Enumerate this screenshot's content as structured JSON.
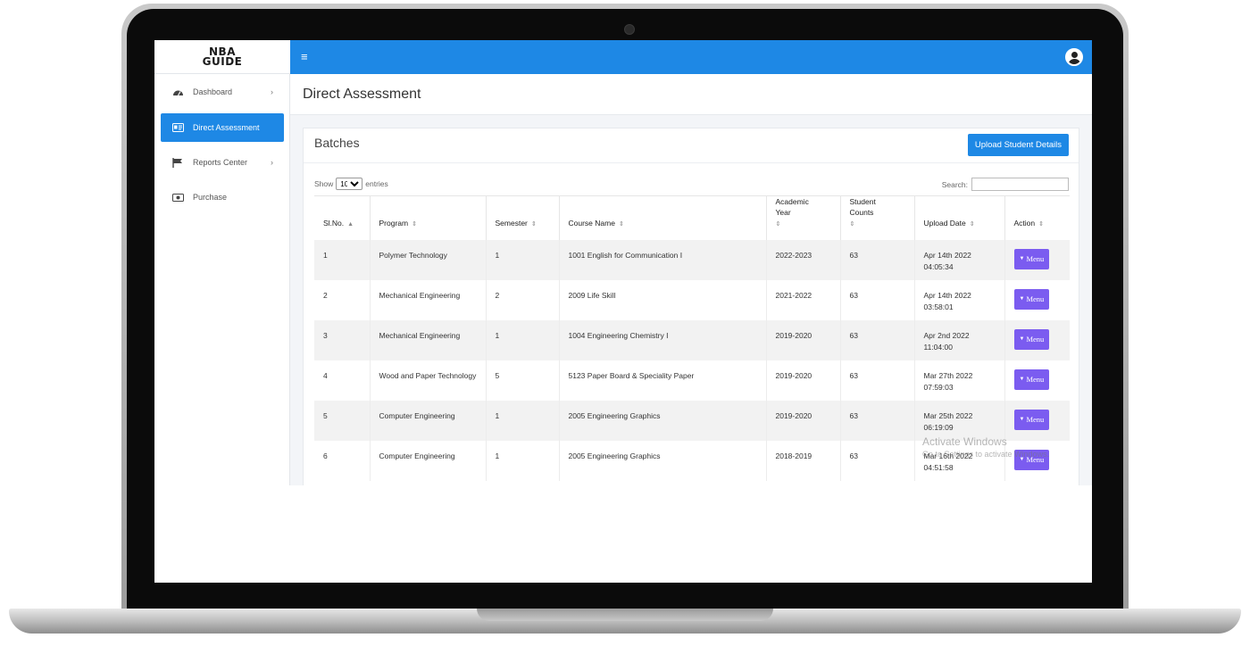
{
  "brand": {
    "logo_line1": "NBA",
    "logo_line2": "GUIDE"
  },
  "topbar": {
    "menu_icon": "hamburger-icon",
    "user_icon": "user-avatar-icon"
  },
  "sidebar": {
    "items": [
      {
        "label": "Dashboard",
        "icon": "dashboard-gauge-icon",
        "has_chevron": true,
        "active": false
      },
      {
        "label": "Direct Assessment",
        "icon": "id-card-icon",
        "has_chevron": false,
        "active": true
      },
      {
        "label": "Reports Center",
        "icon": "flag-icon",
        "has_chevron": true,
        "active": false
      },
      {
        "label": "Purchase",
        "icon": "money-bill-icon",
        "has_chevron": false,
        "active": false
      }
    ]
  },
  "page": {
    "title": "Direct Assessment"
  },
  "batches": {
    "title": "Batches",
    "upload_label": "Upload Student Details",
    "show_label": "Show",
    "entries_value": "10",
    "entries_label": "entries",
    "search_label": "Search:",
    "columns": [
      "Sl.No.",
      "Program",
      "Semester",
      "Course Name",
      "Academic Year",
      "Student Counts",
      "Upload Date",
      "Action"
    ],
    "rows": [
      {
        "sl": "1",
        "program": "Polymer Technology",
        "semester": "1",
        "course": "1001 English for Communication I",
        "year": "2022-2023",
        "count": "63",
        "date": "Apr 14th 2022",
        "time": "04:05:34",
        "action": "Menu"
      },
      {
        "sl": "2",
        "program": "Mechanical Engineering",
        "semester": "2",
        "course": "2009 Life Skill",
        "year": "2021-2022",
        "count": "63",
        "date": "Apr 14th 2022",
        "time": "03:58:01",
        "action": "Menu"
      },
      {
        "sl": "3",
        "program": "Mechanical Engineering",
        "semester": "1",
        "course": "1004 Engineering Chemistry I",
        "year": "2019-2020",
        "count": "63",
        "date": "Apr 2nd 2022",
        "time": "11:04:00",
        "action": "Menu"
      },
      {
        "sl": "4",
        "program": "Wood and Paper Technology",
        "semester": "5",
        "course": "5123 Paper Board & Speciality Paper",
        "year": "2019-2020",
        "count": "63",
        "date": "Mar 27th 2022",
        "time": "07:59:03",
        "action": "Menu"
      },
      {
        "sl": "5",
        "program": "Computer Engineering",
        "semester": "1",
        "course": "2005 Engineering Graphics",
        "year": "2019-2020",
        "count": "63",
        "date": "Mar 25th 2022",
        "time": "06:19:09",
        "action": "Menu"
      },
      {
        "sl": "6",
        "program": "Computer Engineering",
        "semester": "1",
        "course": "2005 Engineering Graphics",
        "year": "2018-2019",
        "count": "63",
        "date": "Mar 16th 2022",
        "time": "04:51:58",
        "action": "Menu"
      }
    ]
  },
  "watermark": {
    "line1": "Activate Windows",
    "line2": "Go to Settings to activate Windows."
  },
  "colors": {
    "topbar": "#1e88e5",
    "active_nav": "#1e88e5",
    "menu_button": "#7b5cf0"
  }
}
